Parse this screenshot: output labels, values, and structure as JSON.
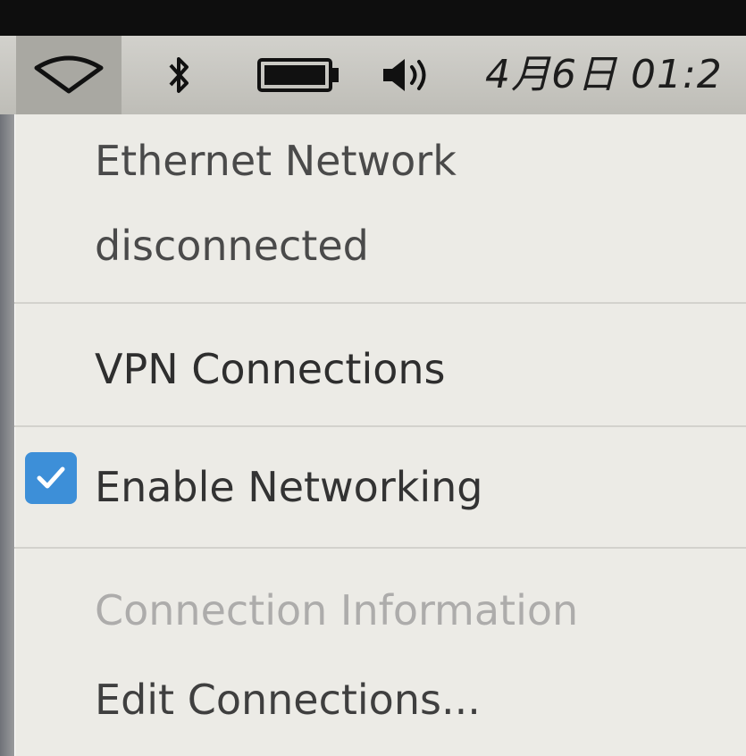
{
  "panel": {
    "clock_text": "4月6日 01:2",
    "indicators": {
      "network": "wifi-icon",
      "bluetooth": "bluetooth-icon",
      "battery": "battery-icon",
      "volume": "volume-icon"
    }
  },
  "menu": {
    "ethernet_header": "Ethernet Network",
    "ethernet_status": "disconnected",
    "vpn_connections": "VPN Connections",
    "enable_networking": {
      "label": "Enable Networking",
      "checked": true
    },
    "connection_information": "Connection Information",
    "edit_connections": "Edit Connections..."
  },
  "colors": {
    "checkbox_accent": "#3d8fd8",
    "menu_background": "#ecebe6",
    "panel_background": "#c9c8c2"
  }
}
